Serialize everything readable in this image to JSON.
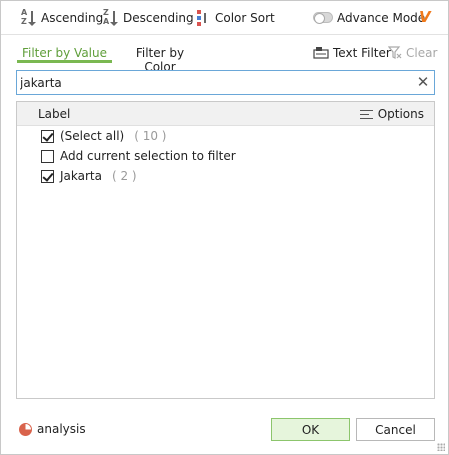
{
  "toolbar": {
    "ascending_label": "Ascending",
    "descending_label": "Descending",
    "color_sort_label": "Color Sort",
    "advance_mode_label": "Advance Mode",
    "advance_mode_on": false,
    "logo_text": "V"
  },
  "tabs": [
    {
      "label": "Filter by Value",
      "active": true
    },
    {
      "label": "Filter by Color",
      "active": false
    }
  ],
  "actions": {
    "text_filter_label": "Text Filter",
    "clear_label": "Clear"
  },
  "search": {
    "value": "jakarta",
    "clear_symbol": "✕"
  },
  "list": {
    "header_label": "Label",
    "options_label": "Options",
    "items": [
      {
        "label": "(Select all)",
        "count": "( 10 )",
        "checked": true
      },
      {
        "label": "Add current selection to filter",
        "count": "",
        "checked": false
      },
      {
        "label": "Jakarta",
        "count": "( 2 )",
        "checked": true
      }
    ]
  },
  "footer": {
    "analysis_label": "analysis",
    "ok_label": "OK",
    "cancel_label": "Cancel"
  },
  "colors": {
    "accent_green": "#7ab851",
    "ok_bg": "#e6f5dc",
    "logo_orange": "#f07a1c",
    "search_border": "#6aa7d8"
  }
}
